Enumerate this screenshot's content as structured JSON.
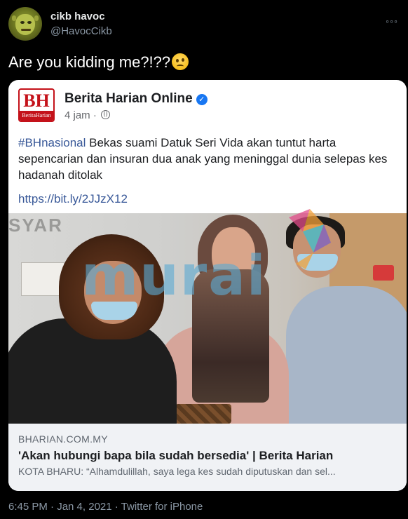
{
  "tweet": {
    "display_name": "cikb havoc",
    "handle": "@HavocCikb",
    "more": "◦◦◦",
    "text": "Are you kidding me?!??",
    "emoji": "woozy-face-emoji",
    "footer": "6:45 PM · Jan 4, 2021 · Twitter for iPhone"
  },
  "embedded_post": {
    "logo_letters": "BH",
    "logo_sub": "BeritaHarian",
    "page_name": "Berita Harian Online",
    "verified": "✓",
    "time": "4 jam ·",
    "hashtag": "#BHnasional",
    "body": " Bekas suami Datuk Seri Vida akan tuntut harta sepencarian dan insuran dua anak yang meninggal dunia selepas kes hadanah ditolak",
    "link": "https://bit.ly/2JJzX12",
    "photo_wall_text": "SYAR",
    "watermark": "murai"
  },
  "link_preview": {
    "domain": "BHARIAN.COM.MY",
    "title": "'Akan hubungi bapa bila sudah bersedia' | Berita Harian",
    "description": "KOTA BHARU: “Alhamdulillah, saya lega kes sudah diputuskan dan sel..."
  },
  "colors": {
    "background": "#000000",
    "card": "#ffffff",
    "fb_link": "#385898",
    "bh_red": "#c4121a",
    "verified_blue": "#1877f2",
    "watermark": "#5caad2"
  }
}
